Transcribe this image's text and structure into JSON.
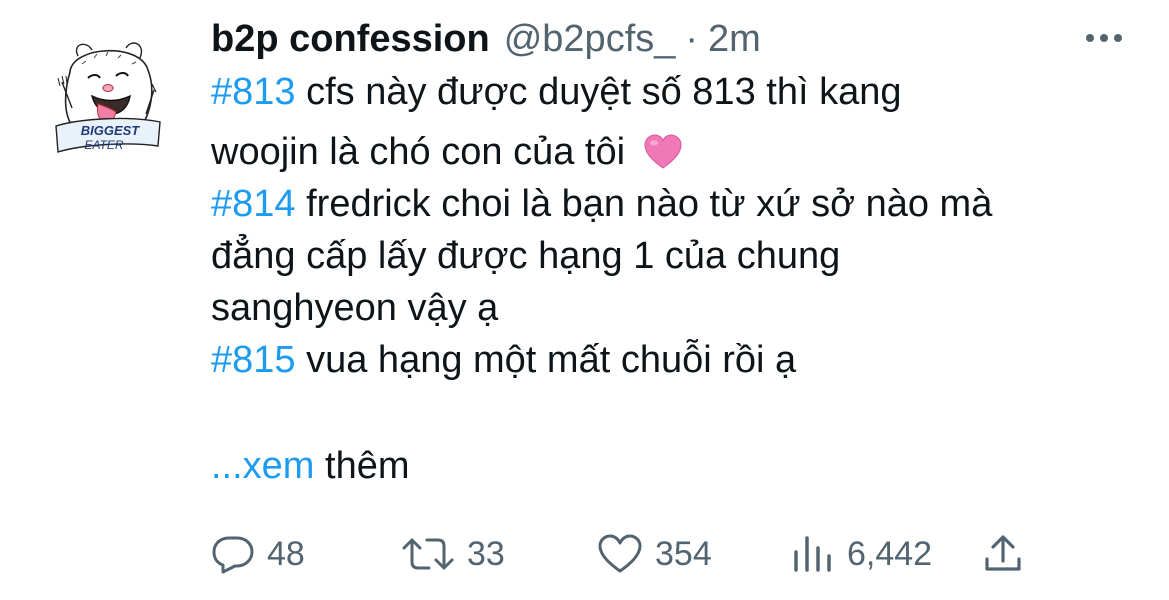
{
  "tweet": {
    "author_name": "b2p confession",
    "handle": "@b2pcfs_",
    "separator": "·",
    "time": "2m",
    "lines": [
      {
        "tag": "#813",
        "text": " cfs này được duyệt số 813 thì kang"
      },
      {
        "tag": "",
        "text": "woojin là chó con của tôi",
        "emoji": "pink-heart"
      },
      {
        "tag": "#814",
        "text": " fredrick choi là bạn nào từ xứ sở nào mà"
      },
      {
        "tag": "",
        "text": "đẳng cấp lấy được hạng 1 của chung"
      },
      {
        "tag": "",
        "text": "sanghyeon vậy ạ"
      },
      {
        "tag": "#815",
        "text": " vua hạng một mất chuỗi rồi ạ"
      }
    ],
    "see_more": {
      "link": "...xem",
      "text": " thêm"
    },
    "metrics": {
      "replies": "48",
      "retweets": "33",
      "likes": "354",
      "views": "6,442"
    },
    "avatar_text": [
      "BIGGEST",
      "EATER"
    ]
  },
  "colors": {
    "text": "#0f1419",
    "secondary": "#536471",
    "accent": "#1d9bf0",
    "heart": "#f178b6"
  },
  "icons": {
    "more": "more-horizontal-icon",
    "reply": "reply-icon",
    "retweet": "retweet-icon",
    "like": "like-icon",
    "views": "views-icon",
    "share": "share-icon"
  }
}
